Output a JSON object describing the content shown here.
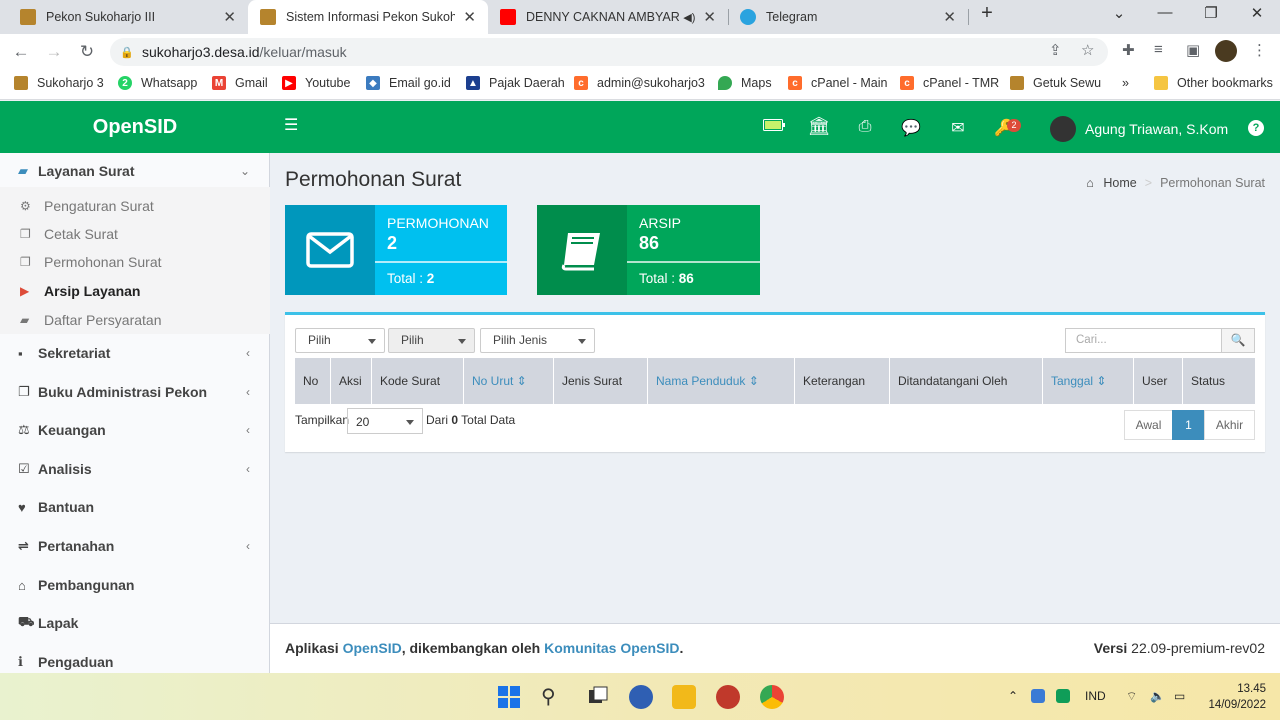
{
  "browser": {
    "tabs": [
      {
        "title": "Pekon Sukoharjo III"
      },
      {
        "title": "Sistem Informasi Pekon Sukoharjo"
      },
      {
        "title": "DENNY CAKNAN AMBYAR \"C"
      },
      {
        "title": "Telegram"
      }
    ],
    "url_host": "sukoharjo3.desa.id",
    "url_path": "/keluar/masuk",
    "bookmarks": [
      "Sukoharjo 3",
      "Whatsapp",
      "Gmail",
      "Youtube",
      "Email go.id",
      "Pajak Daerah",
      "admin@sukoharjo3",
      "Maps",
      "cPanel - Main",
      "cPanel - TMR",
      "Getuk Sewu"
    ],
    "other_bookmarks": "Other bookmarks",
    "overflow": "»"
  },
  "header": {
    "logo": "OpenSID",
    "notif_badge": "2",
    "user_name": "Agung Triawan, S.Kom",
    "help": "?"
  },
  "sidebar": {
    "layanan": "Layanan Surat",
    "sub": [
      "Pengaturan Surat",
      "Cetak Surat",
      "Permohonan Surat",
      "Arsip Layanan",
      "Daftar Persyaratan"
    ],
    "items": [
      "Sekretariat",
      "Buku Administrasi Pekon",
      "Keuangan",
      "Analisis",
      "Bantuan",
      "Pertanahan",
      "Pembangunan",
      "Lapak",
      "Pengaduan"
    ]
  },
  "page": {
    "title": "Permohonan Surat",
    "crumb_home": "Home",
    "crumb_current": "Permohonan Surat"
  },
  "cards": {
    "permohonan": {
      "label": "PERMOHONAN",
      "value": "2",
      "total_label": "Total :",
      "total": "2",
      "color": "#0097bc"
    },
    "arsip": {
      "label": "ARSIP",
      "value": "86",
      "total_label": "Total :",
      "total": "86",
      "color": "#00a65a"
    }
  },
  "filters": {
    "tahun": "Pilih Tahun",
    "bulan": "Pilih Bulan",
    "jenis": "Pilih Jenis Surat",
    "search_placeholder": "Cari..."
  },
  "table": {
    "headers": [
      "No",
      "Aksi",
      "Kode Surat",
      "No Urut",
      "Jenis Surat",
      "Nama Penduduk",
      "Keterangan",
      "Ditandatangani Oleh",
      "Tanggal",
      "User",
      "Status"
    ]
  },
  "pagination": {
    "show_label": "Tampilkan",
    "page_size": "20",
    "dari": "Dari",
    "total_count": "0",
    "total_label": "Total Data",
    "first": "Awal",
    "current": "1",
    "last": "Akhir"
  },
  "footer": {
    "prefix": "Aplikasi",
    "app": "OpenSID",
    "mid": ", dikembangkan oleh",
    "community": "Komunitas OpenSID",
    "dot": ".",
    "version_label": "Versi",
    "version": "22.09-premium-rev02"
  },
  "taskbar": {
    "lang": "IND",
    "time": "13.45",
    "date": "14/09/2022"
  }
}
